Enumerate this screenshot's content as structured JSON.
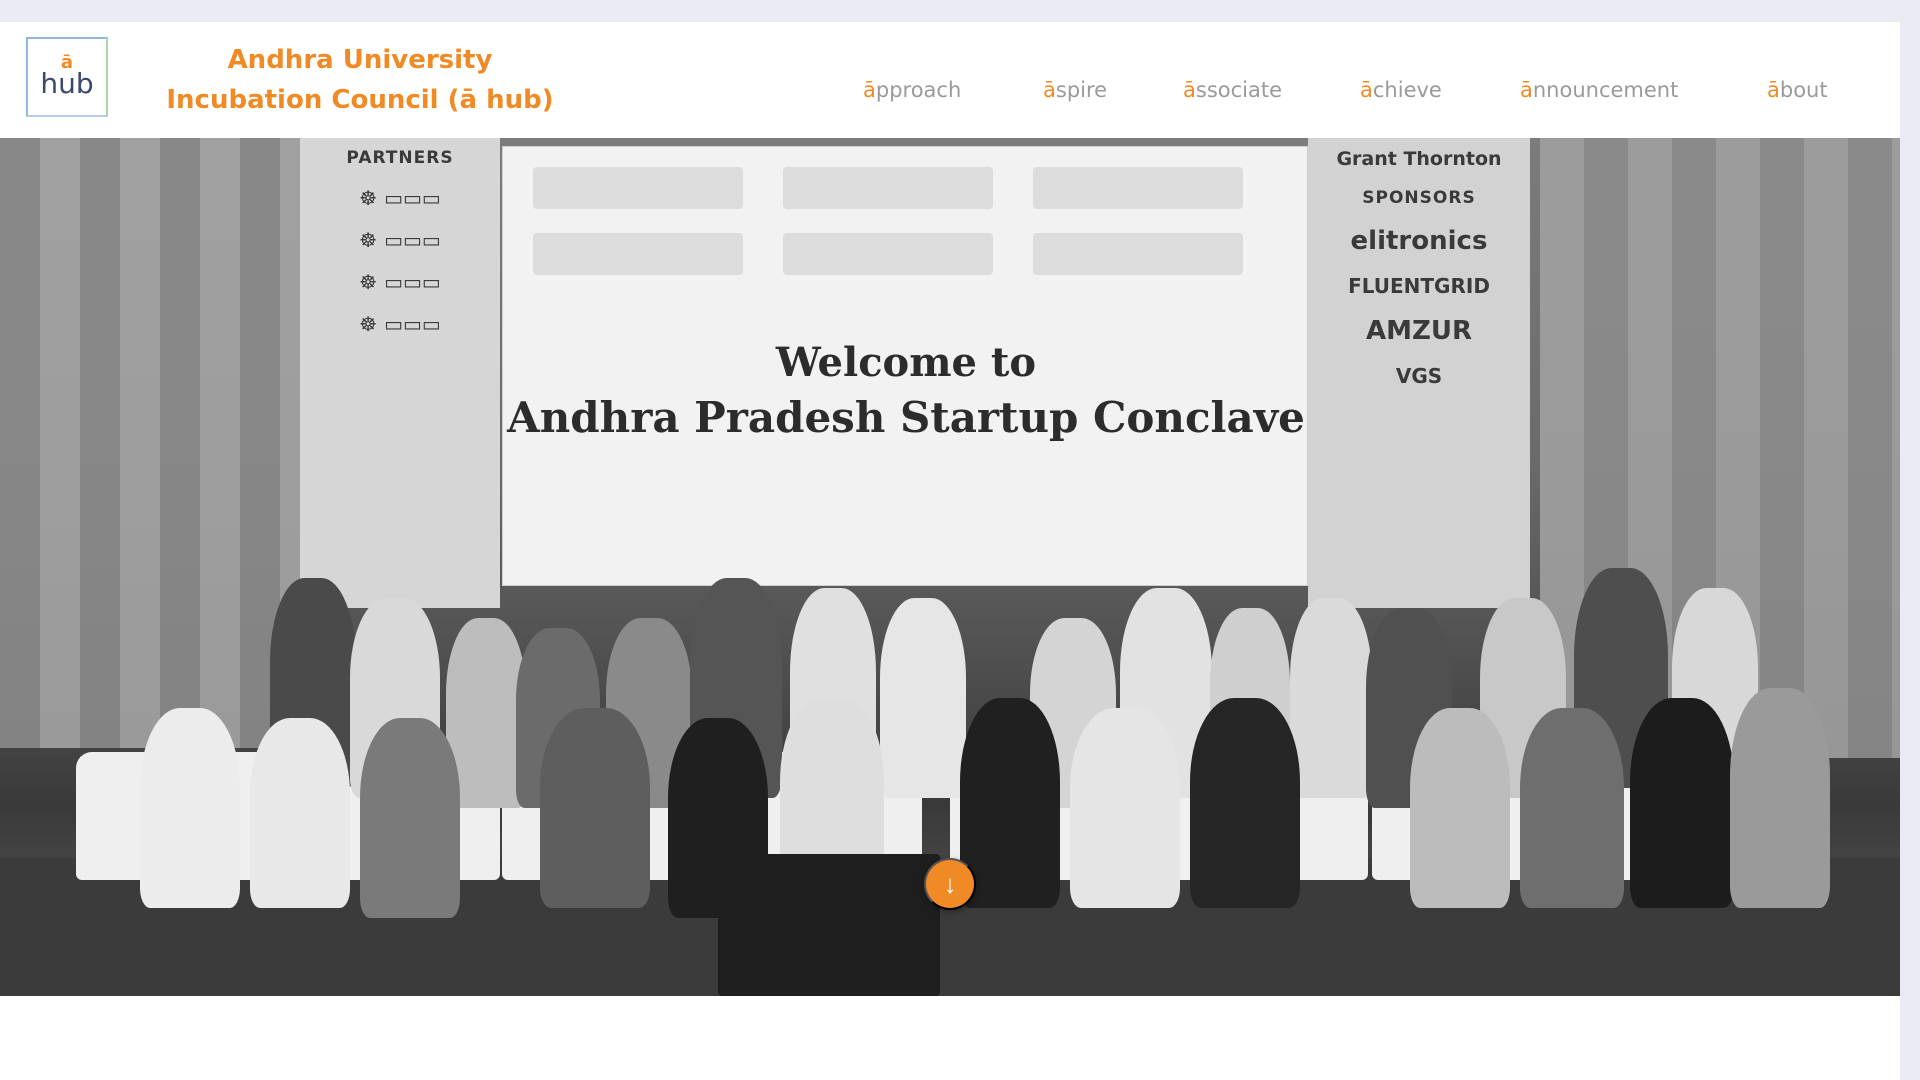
{
  "brand": {
    "logo_accent": "ā",
    "logo_text": "hub",
    "title_line1": "Andhra University",
    "title_line2": "Incubation Council (ā hub)"
  },
  "nav": {
    "items": [
      {
        "accent": "ā",
        "label": "pproach"
      },
      {
        "accent": "ā",
        "label": "spire"
      },
      {
        "accent": "ā",
        "label": "ssociate"
      },
      {
        "accent": "ā",
        "label": "chieve"
      },
      {
        "accent": "ā",
        "label": "nnouncement"
      },
      {
        "accent": "ā",
        "label": "bout"
      }
    ]
  },
  "hero": {
    "partners_heading": "PARTNERS",
    "sponsors_heading": "SPONSORS",
    "sponsor_logos": [
      "Grant Thornton",
      "elitronics",
      "FLUENTGRID",
      "AMZUR",
      "VGS"
    ],
    "welcome_line1": "Welcome to",
    "welcome_line2": "Andhra Pradesh Startup Conclave",
    "scroll_icon": "arrow-down-icon"
  },
  "colors": {
    "accent": "#f08a24",
    "nav_text": "#9a9a9a"
  }
}
